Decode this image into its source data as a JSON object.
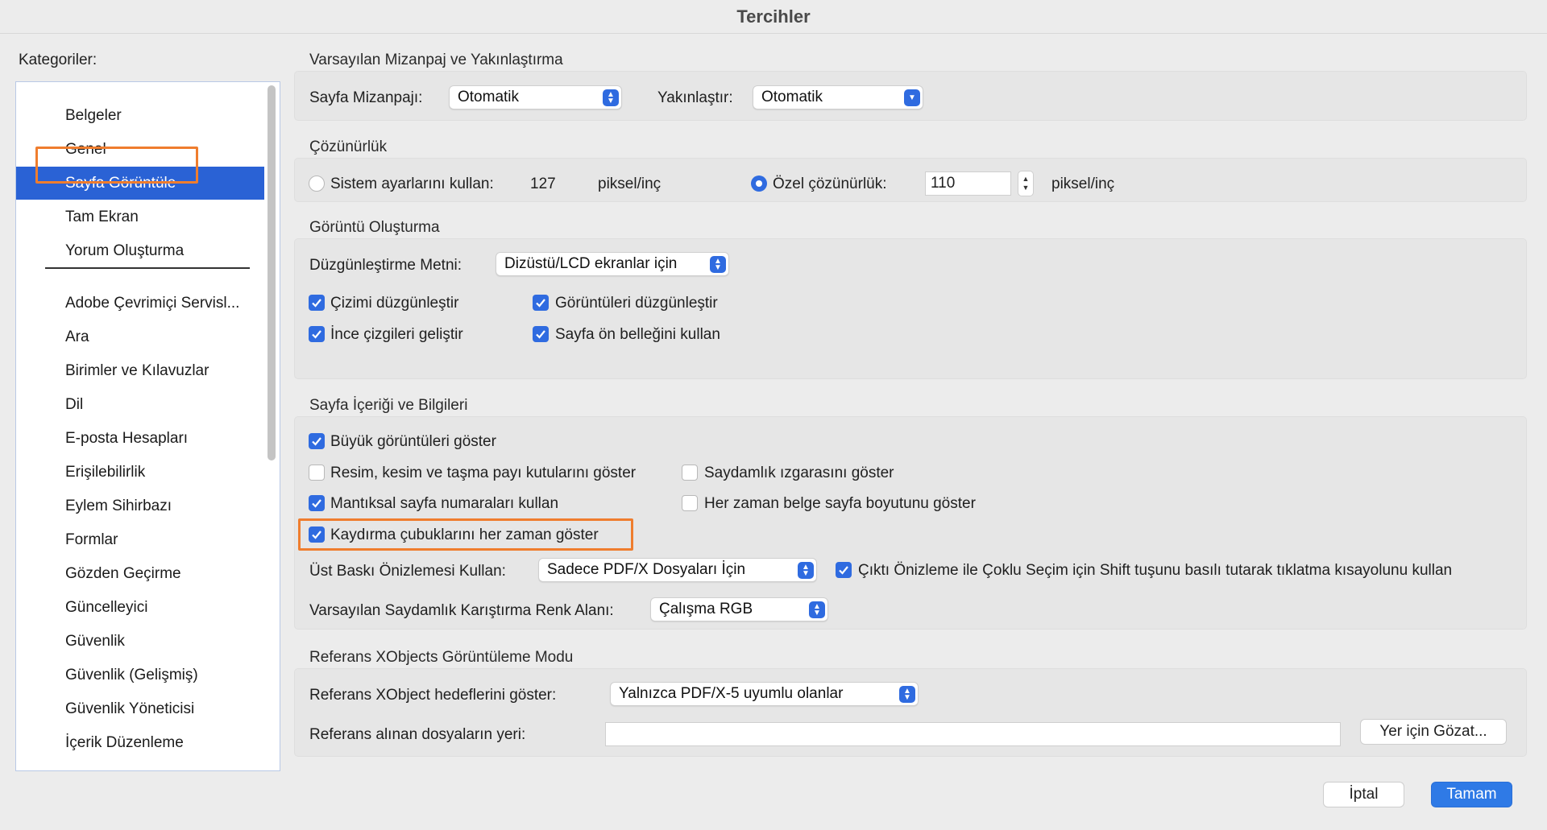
{
  "window": {
    "title": "Tercihler"
  },
  "categories": {
    "label": "Kategoriler:",
    "items": [
      "Belgeler",
      "Genel",
      "Sayfa Görüntüle",
      "Tam Ekran",
      "Yorum Oluşturma",
      "Adobe Çevrimiçi Servisl...",
      "Ara",
      "Birimler ve Kılavuzlar",
      "Dil",
      "E-posta Hesapları",
      "Erişilebilirlik",
      "Eylem Sihirbazı",
      "Formlar",
      "Gözden Geçirme",
      "Güncelleyici",
      "Güvenlik",
      "Güvenlik (Gelişmiş)",
      "Güvenlik Yöneticisi",
      "İçerik Düzenleme"
    ],
    "selected": "Sayfa Görüntüle"
  },
  "layout_zoom": {
    "title": "Varsayılan Mizanpaj ve Yakınlaştırma",
    "layout_label": "Sayfa Mizanpajı:",
    "layout_value": "Otomatik",
    "zoom_label": "Yakınlaştır:",
    "zoom_value": "Otomatik"
  },
  "resolution": {
    "title": "Çözünürlük",
    "system_label": "Sistem ayarlarını kullan:",
    "system_value": "127",
    "system_unit": "piksel/inç",
    "system_checked": false,
    "custom_label": "Özel çözünürlük:",
    "custom_value": "110",
    "custom_unit": "piksel/inç",
    "custom_checked": true
  },
  "rendering": {
    "title": "Görüntü Oluşturma",
    "smooth_text_label": "Düzgünleştirme Metni:",
    "smooth_text_value": "Dizüstü/LCD ekranlar için",
    "smooth_line_art": "Çizimi düzgünleştir",
    "smooth_images": "Görüntüleri düzgünleştir",
    "enhance_thin_lines": "İnce çizgileri geliştir",
    "use_page_cache": "Sayfa ön belleğini kullan"
  },
  "page_content": {
    "title": "Sayfa İçeriği ve Bilgileri",
    "show_large_images": "Büyük görüntüleri göster",
    "show_art_trim_bleed": "Resim, kesim ve taşma payı kutularını göster",
    "show_transparency_grid": "Saydamlık ızgarasını göster",
    "use_logical_page_numbers": "Mantıksal sayfa numaraları kullan",
    "always_show_doc_page_size": "Her zaman belge sayfa boyutunu göster",
    "always_show_scrollbars": "Kaydırma çubuklarını her zaman göster",
    "overprint_label": "Üst Baskı Önizlemesi Kullan:",
    "overprint_value": "Sadece PDF/X Dosyaları İçin",
    "output_preview_shortcut": "Çıktı Önizleme ile Çoklu Seçim için Shift tuşunu basılı tutarak tıklatma kısayolunu kullan",
    "blend_space_label": "Varsayılan Saydamlık Karıştırma Renk Alanı:",
    "blend_space_value": "Çalışma RGB"
  },
  "xobjects": {
    "title": "Referans XObjects Görüntüleme Modu",
    "targets_label": "Referans XObject hedeflerini göster:",
    "targets_value": "Yalnızca PDF/X-5 uyumlu olanlar",
    "location_label": "Referans alınan dosyaların yeri:",
    "location_value": "",
    "browse_button": "Yer için Gözat..."
  },
  "footer": {
    "cancel": "İptal",
    "ok": "Tamam"
  },
  "colors": {
    "accent": "#2f6be0",
    "selection": "#2a62d5",
    "highlight": "#ef7d2e"
  }
}
